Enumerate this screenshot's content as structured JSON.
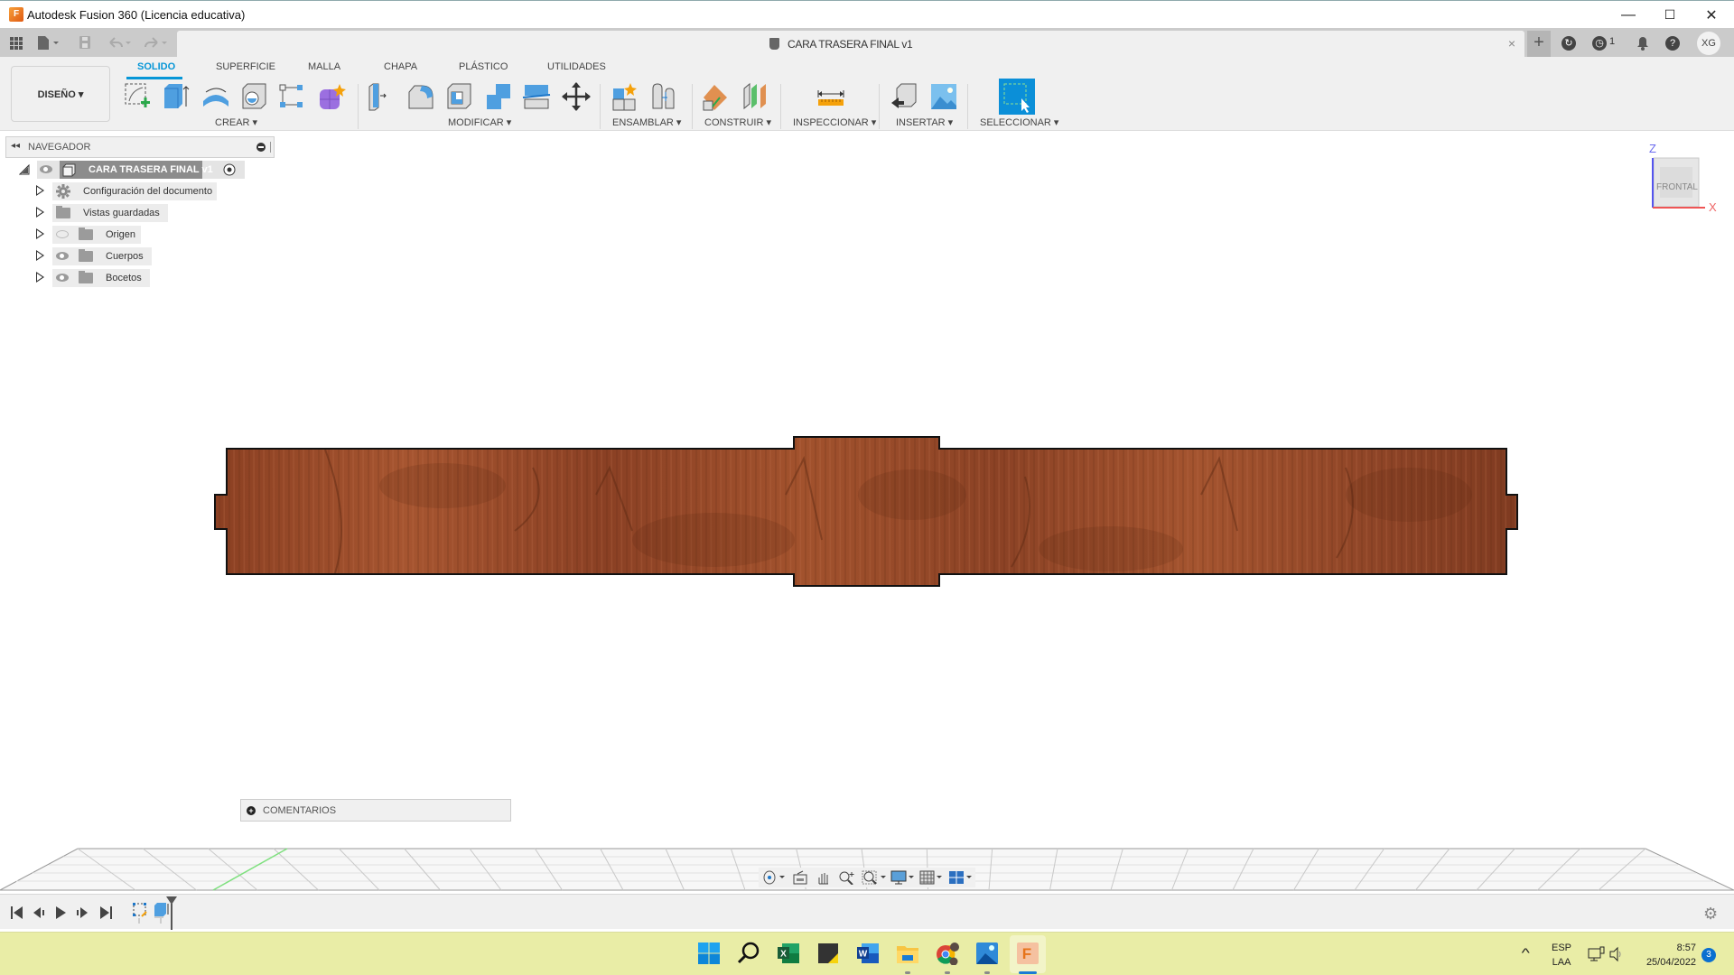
{
  "window": {
    "title": "Autodesk Fusion 360 (Licencia educativa)",
    "logo_letter": "F",
    "minimize": "—",
    "maximize": "☐",
    "close": "✕"
  },
  "document_tab": {
    "title": "CARA TRASERA FINAL v1",
    "close": "×",
    "new_tab": "+"
  },
  "header_right": {
    "jobs_count": "1",
    "avatar_initials": "XG"
  },
  "ribbon": {
    "workspace": "DISEÑO ▾",
    "tabs": [
      {
        "label": "SOLIDO",
        "active": true
      },
      {
        "label": "SUPERFICIE",
        "active": false
      },
      {
        "label": "MALLA",
        "active": false
      },
      {
        "label": "CHAPA",
        "active": false
      },
      {
        "label": "PLÁSTICO",
        "active": false
      },
      {
        "label": "UTILIDADES",
        "active": false
      }
    ],
    "groups": [
      {
        "label": "CREAR ▾",
        "tools": [
          "create-sketch-icon",
          "extrude-icon",
          "revolve-icon",
          "hole-icon",
          "pattern-icon",
          "create-form-icon"
        ]
      },
      {
        "label": "MODIFICAR ▾",
        "tools": [
          "press-pull-icon",
          "fillet-icon",
          "shell-icon",
          "combine-icon",
          "split-body-icon",
          "move-icon"
        ]
      },
      {
        "label": "ENSAMBLAR ▾",
        "tools": [
          "new-component-icon",
          "joint-icon"
        ]
      },
      {
        "label": "CONSTRUIR ▾",
        "tools": [
          "offset-plane-icon",
          "midplane-icon"
        ]
      },
      {
        "label": "INSPECCIONAR ▾",
        "tools": [
          "measure-icon"
        ]
      },
      {
        "label": "INSERTAR ▾",
        "tools": [
          "insert-derive-icon",
          "insert-canvas-icon"
        ]
      },
      {
        "label": "SELECCIONAR ▾",
        "tools": [
          "select-icon"
        ]
      }
    ]
  },
  "navigator": {
    "title": "NAVEGADOR",
    "root": "CARA TRASERA  FINAL v1",
    "items": [
      {
        "label": "Configuración del documento",
        "icon": "gear-icon",
        "visible": null
      },
      {
        "label": "Vistas guardadas",
        "icon": "folder-icon",
        "visible": null
      },
      {
        "label": "Origen",
        "icon": "folder-icon",
        "visible": false
      },
      {
        "label": "Cuerpos",
        "icon": "folder-icon",
        "visible": true
      },
      {
        "label": "Bocetos",
        "icon": "folder-icon",
        "visible": true
      }
    ]
  },
  "viewcube": {
    "face": "FRONTAL",
    "axis_z": "Z",
    "axis_x": "X"
  },
  "comments": {
    "label": "COMENTARIOS",
    "icon": "+"
  },
  "navbar": {
    "tools": [
      "orbit-icon",
      "look-at-icon",
      "pan-icon",
      "zoom-icon",
      "fit-icon",
      "display-settings-icon",
      "grid-settings-icon",
      "viewports-icon"
    ]
  },
  "timeline": {
    "controls": [
      "first-icon",
      "previous-icon",
      "play-icon",
      "next-icon",
      "last-icon"
    ],
    "features": [
      "sketch-feature-icon",
      "extrude-feature-icon"
    ]
  },
  "taskbar": {
    "apps": [
      "windows-start-icon",
      "search-icon",
      "excel-icon",
      "sticky-notes-icon",
      "word-icon",
      "file-explorer-icon",
      "chrome-icon",
      "photos-icon",
      "fusion360-icon"
    ],
    "language_top": "ESP",
    "language_bottom": "LAA",
    "time": "8:57",
    "date": "25/04/2022",
    "notifications": "3",
    "tray_chevron": "^"
  },
  "colors": {
    "accent": "#0696d7",
    "wood": "#8a4325",
    "taskbar": "#e9eda6"
  }
}
